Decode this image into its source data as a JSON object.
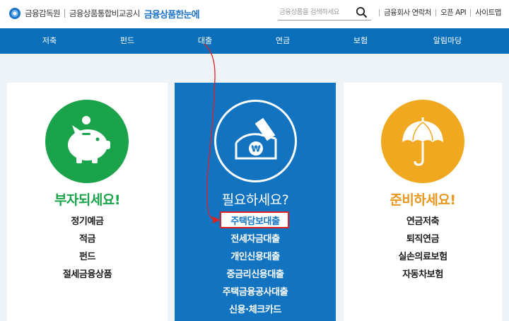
{
  "header": {
    "org_name": "금융감독원",
    "site_name": "금융상품통합비교공시",
    "brand": "금융상품한눈에",
    "search_placeholder": "금융상품을 검색하세요",
    "util_links": [
      "금융회사 연락처",
      "오픈 API",
      "사이트맵"
    ]
  },
  "nav": {
    "items": [
      "저축",
      "펀드",
      "대출",
      "연금",
      "보험",
      "알림마당"
    ]
  },
  "cards": {
    "left": {
      "title": "부자되세요!",
      "icon": "piggy-bank-icon",
      "items": [
        "정기예금",
        "적금",
        "펀드",
        "절세금융상품"
      ]
    },
    "middle": {
      "title": "필요하세요?",
      "icon": "won-envelope-icon",
      "items": [
        "주택담보대출",
        "전세자금대출",
        "개인신용대출",
        "중금리신용대출",
        "주택금융공사대출",
        "신용·체크카드"
      ]
    },
    "right": {
      "title": "준비하세요!",
      "icon": "umbrella-icon",
      "items": [
        "연금저축",
        "퇴직연금",
        "실손의료보험",
        "자동차보험"
      ]
    }
  },
  "colors": {
    "nav_blue": "#0a6fba",
    "card_blue": "#1273c0",
    "green": "#1aa34a",
    "orange": "#f0a821",
    "annotation_red": "#e02020"
  }
}
